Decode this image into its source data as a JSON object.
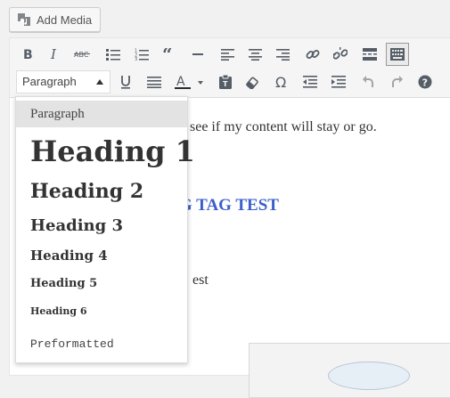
{
  "add_media": {
    "label": "Add Media",
    "icon": "media-icon"
  },
  "toolbar": {
    "row1": [
      {
        "name": "bold",
        "icon": "bold-icon"
      },
      {
        "name": "italic",
        "icon": "italic-icon"
      },
      {
        "name": "strikethrough",
        "icon": "strikethrough-icon"
      },
      {
        "name": "bulleted-list",
        "icon": "bulleted-list-icon"
      },
      {
        "name": "numbered-list",
        "icon": "numbered-list-icon"
      },
      {
        "name": "blockquote",
        "icon": "blockquote-icon"
      },
      {
        "name": "horizontal-line",
        "icon": "horizontal-line-icon"
      },
      {
        "name": "align-left",
        "icon": "align-left-icon"
      },
      {
        "name": "align-center",
        "icon": "align-center-icon"
      },
      {
        "name": "align-right",
        "icon": "align-right-icon"
      },
      {
        "name": "insert-link",
        "icon": "link-icon"
      },
      {
        "name": "remove-link",
        "icon": "unlink-icon"
      },
      {
        "name": "read-more",
        "icon": "read-more-icon"
      },
      {
        "name": "toolbar-toggle",
        "icon": "toolbar-toggle-icon",
        "active": true
      }
    ],
    "row2": [
      {
        "name": "underline",
        "icon": "underline-icon"
      },
      {
        "name": "justify",
        "icon": "justify-icon"
      },
      {
        "name": "text-color",
        "icon": "text-color-icon",
        "color": "#2b2b2b"
      },
      {
        "name": "paste-as-text",
        "icon": "clipboard-icon"
      },
      {
        "name": "clear-formatting",
        "icon": "eraser-icon"
      },
      {
        "name": "special-character",
        "icon": "omega-icon"
      },
      {
        "name": "decrease-indent",
        "icon": "outdent-icon"
      },
      {
        "name": "increase-indent",
        "icon": "indent-icon"
      },
      {
        "name": "undo",
        "icon": "undo-icon"
      },
      {
        "name": "redo",
        "icon": "redo-icon"
      },
      {
        "name": "keyboard-shortcuts",
        "icon": "help-icon"
      }
    ],
    "format_select": {
      "value": "Paragraph",
      "icon": "caret-up-icon"
    }
  },
  "format_dropdown": {
    "selected": "Paragraph",
    "items": [
      "Paragraph",
      "Heading 1",
      "Heading 2",
      "Heading 3",
      "Heading 4",
      "Heading 5",
      "Heading 6",
      "Preformatted"
    ]
  },
  "content": {
    "line1": "see if my content will stay or go.",
    "heading_fragment": "G TAG TEST",
    "text_fragment": "est"
  },
  "colors": {
    "accent_link": "#3c5fcc",
    "toolbar_bg": "#f5f5f5",
    "text": "#333333"
  }
}
